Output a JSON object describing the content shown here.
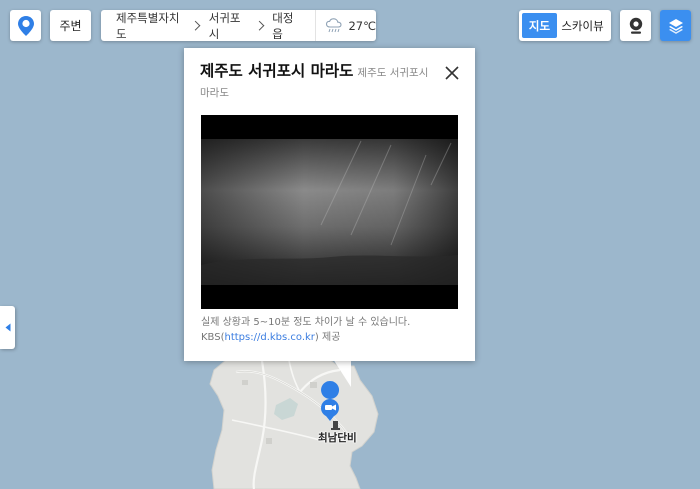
{
  "topbar": {
    "nearby_label": "주변",
    "breadcrumb": [
      "제주특별자치도",
      "서귀포시",
      "대정읍"
    ],
    "weather_temp": "27℃",
    "map_type_map": "지도",
    "map_type_sky": "스카이뷰"
  },
  "popup": {
    "title": "제주도 서귀포시 마라도",
    "subtitle": "제주도 서귀포시 마라도",
    "note_line1": "실제 상황과 5~10분 정도 차이가 날 수 있습니다.",
    "note_prefix": "KBS(",
    "note_link": "https://d.kbs.co.kr",
    "note_suffix": ") 제공"
  },
  "map": {
    "place_label": "최남단비"
  },
  "icons": {
    "location_pin": "map-pin-icon",
    "weather": "rain-cloud-icon",
    "streetview": "streetview-camera-icon",
    "layers": "layers-icon",
    "collapse": "caret-left-icon",
    "close": "close-icon",
    "cctv_marker": "cctv-marker-icon",
    "monument": "monument-icon"
  },
  "colors": {
    "sea": "#9cb7cc",
    "land": "#e2e2df",
    "accent": "#3b8ff0",
    "link": "#3b7de0"
  }
}
